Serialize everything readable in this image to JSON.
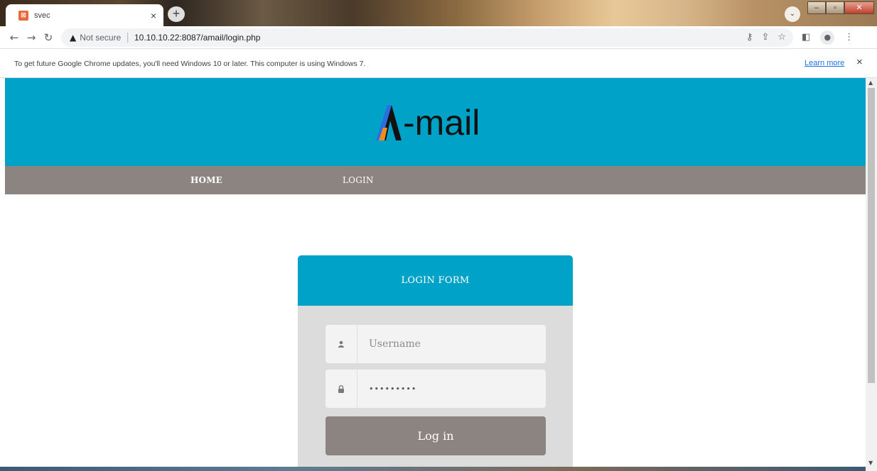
{
  "browser": {
    "tab_title": "svec",
    "tab_close": "×",
    "new_tab": "+",
    "security_label": "Not secure",
    "url": "10.10.10.22:8087/amail/login.php",
    "infobar_text": "To get future Google Chrome updates, you'll need Windows 10 or later. This computer is using Windows 7.",
    "infobar_link": "Learn more",
    "infobar_close": "×"
  },
  "site": {
    "logo_text": "-mail",
    "logo_letter": "A",
    "nav": [
      {
        "label": "HOME"
      },
      {
        "label": "LOGIN"
      }
    ],
    "colors": {
      "header": "#00a3c7",
      "nav": "#8c8480",
      "card": "#dcdcdc"
    }
  },
  "login": {
    "title": "LOGIN FORM",
    "username_placeholder": "Username",
    "password_value": "•••••••••",
    "submit_label": "Log in"
  }
}
